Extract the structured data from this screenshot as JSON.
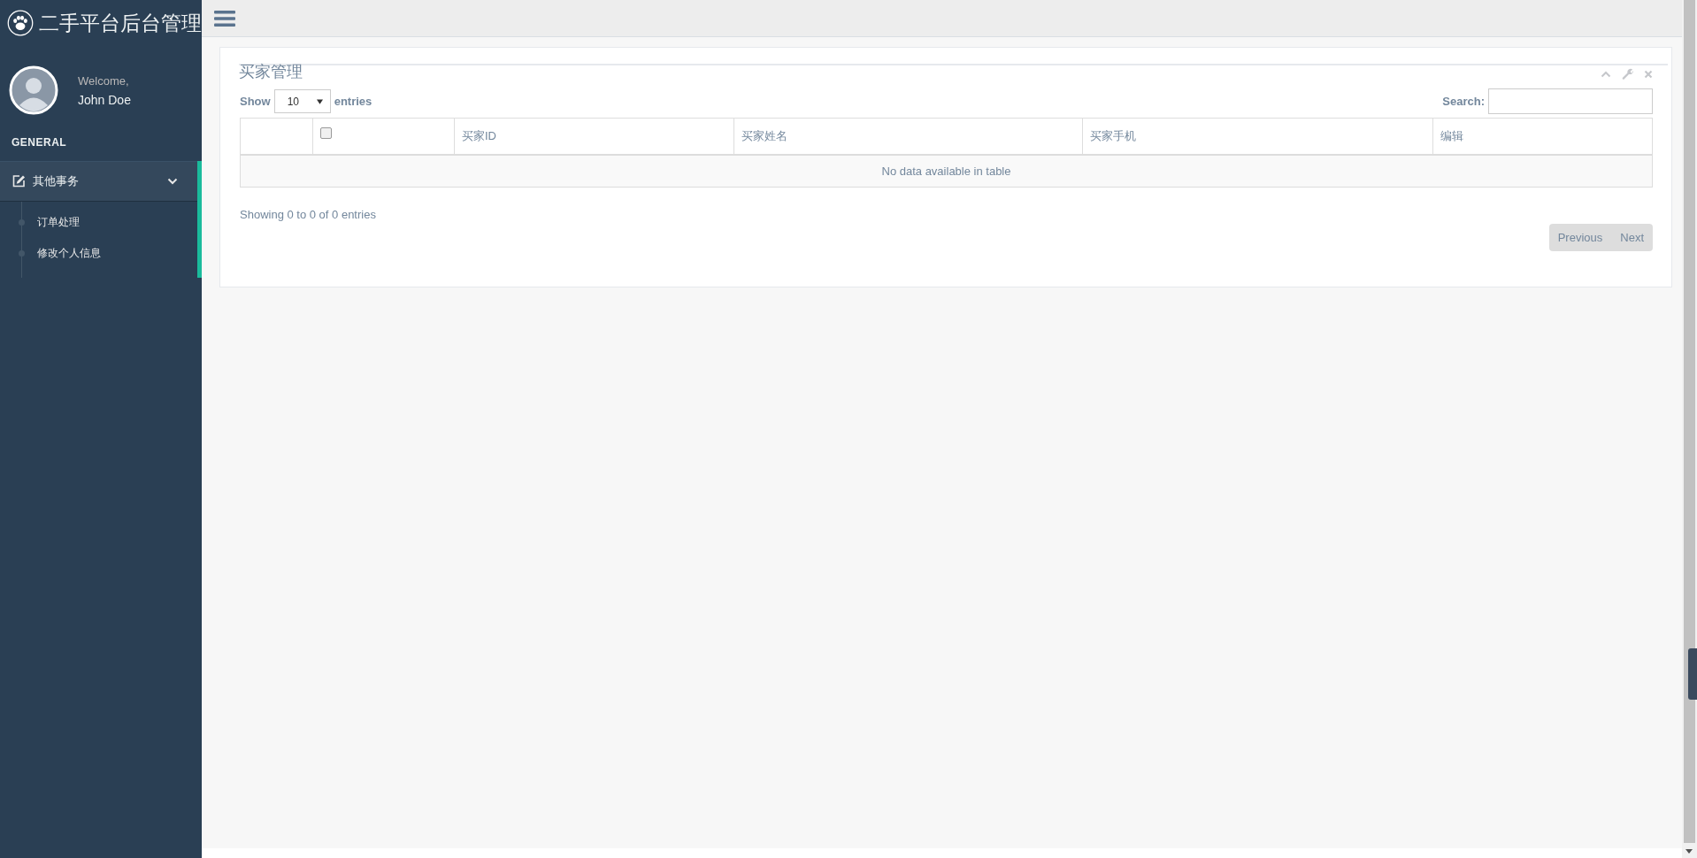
{
  "brand": {
    "title": "二手平台后台管理"
  },
  "profile": {
    "greeting": "Welcome,",
    "name": "John Doe"
  },
  "sidebar": {
    "section": "GENERAL",
    "items": [
      {
        "label": "其他事务",
        "expanded": true,
        "children": [
          {
            "label": "订单处理",
            "selected": false
          },
          {
            "label": "修改个人信息",
            "selected": false
          }
        ]
      }
    ]
  },
  "panel": {
    "title": "买家管理",
    "length": {
      "prefix": "Show",
      "value": "10",
      "suffix": "entries"
    },
    "search": {
      "label": "Search:"
    },
    "table": {
      "columns": [
        {
          "kind": "blank"
        },
        {
          "kind": "checkbox",
          "checked": false
        },
        {
          "kind": "text",
          "label": "买家ID"
        },
        {
          "kind": "text",
          "label": "买家姓名"
        },
        {
          "kind": "text",
          "label": "买家手机"
        },
        {
          "kind": "text",
          "label": "编辑"
        }
      ],
      "empty_message": "No data available in table"
    },
    "info": "Showing 0 to 0 of 0 entries",
    "pagination": [
      "Previous",
      "Next"
    ]
  }
}
